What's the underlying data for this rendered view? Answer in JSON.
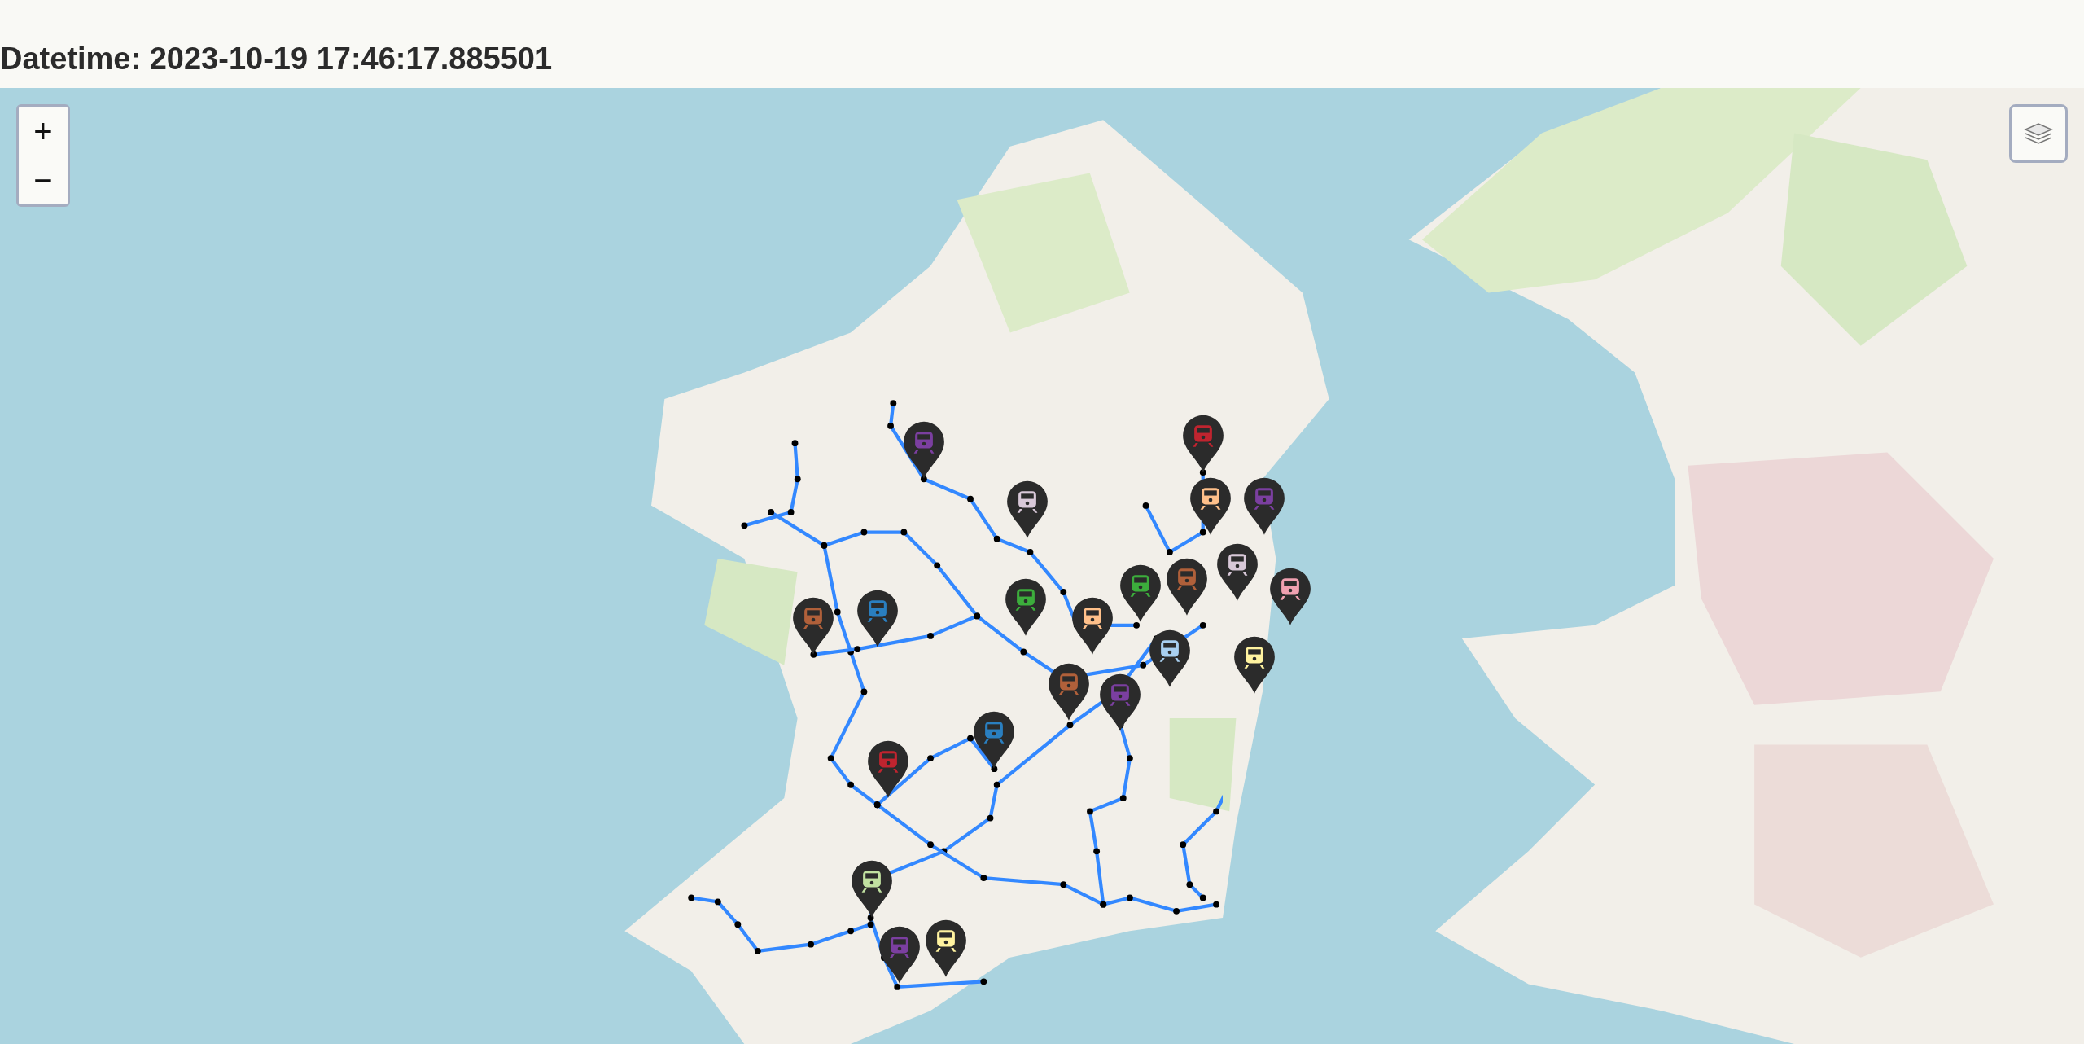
{
  "header": {
    "datetime": "Datetime: 2023-10-19 17:46:17.885501"
  },
  "map": {
    "kind": "picture",
    "zoom_in": "+",
    "zoom_out": "−",
    "markers": [
      {
        "color": "#7b3fa0"
      },
      {
        "color": "#d8c8d8"
      },
      {
        "color": "#c0242f"
      },
      {
        "color": "#b0603a"
      },
      {
        "color": "#2a7fc0"
      },
      {
        "color": "#3cad3c"
      },
      {
        "color": "#3cad3c"
      },
      {
        "color": "#ffc08a"
      },
      {
        "color": "#7b3fa0"
      },
      {
        "color": "#d8c8d8"
      },
      {
        "color": "#f0a0b0"
      },
      {
        "color": "#b0603a"
      },
      {
        "color": "#a8cff0"
      },
      {
        "color": "#ffc08a"
      },
      {
        "color": "#b0603a"
      },
      {
        "color": "#7b3fa0"
      },
      {
        "color": "#fff3a0"
      },
      {
        "color": "#2a7fc0"
      },
      {
        "color": "#c0242f"
      },
      {
        "color": "#c0e0a0"
      },
      {
        "color": "#7b3fa0"
      },
      {
        "color": "#fff3a0"
      }
    ]
  }
}
